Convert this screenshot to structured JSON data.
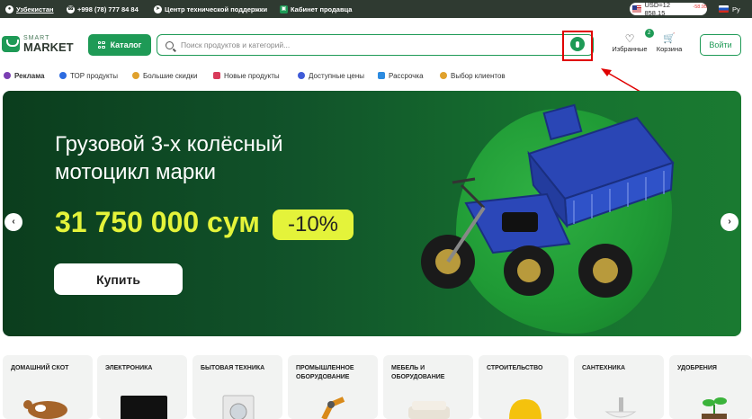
{
  "topbar": {
    "region": "Узбекистан",
    "phone": "+998 (78) 777 84 84",
    "support": "Центр технической поддержки",
    "seller": "Кабинет продавца",
    "currency_value": "USD=12 858.15",
    "currency_delta": "-58.95",
    "language": "Ру"
  },
  "header": {
    "logo_top": "SMART",
    "logo_bottom": "MARKET",
    "catalog_label": "Каталог",
    "search_placeholder": "Поиск продуктов и категорий...",
    "favorites_label": "Избранные",
    "favorites_count": "2",
    "cart_label": "Корзина",
    "login_label": "Войти"
  },
  "nav": {
    "items": [
      {
        "label": "Реклама",
        "color": "#7b3fb3"
      },
      {
        "label": "ТОР продукты",
        "color": "#2c6be0"
      },
      {
        "label": "Большие скидки",
        "color": "#e0a12c"
      },
      {
        "label": "Новые продукты",
        "color": "#d83a5a"
      },
      {
        "label": "Доступные цены",
        "color": "#3f5bd8"
      },
      {
        "label": "Рассрочка",
        "color": "#2c8be0"
      },
      {
        "label": "Выбор клиентов",
        "color": "#e0a12c"
      }
    ]
  },
  "hero": {
    "title": "Грузовой 3-х колёсный мотоцикл марки",
    "price": "31 750 000 сум",
    "discount": "-10%",
    "buy_label": "Купить"
  },
  "categories": [
    {
      "label": "ДОМАШНИЙ СКОТ"
    },
    {
      "label": "ЭЛЕКТРОНИКА"
    },
    {
      "label": "БЫТОВАЯ ТЕХНИКА"
    },
    {
      "label": "ПРОМЫШЛЕННОЕ ОБОРУДОВАНИЕ"
    },
    {
      "label": "МЕБЕЛЬ И ОБОРУДОВАНИЕ"
    },
    {
      "label": "СТРОИТЕЛЬСТВО"
    },
    {
      "label": "САНТЕХНИКА"
    },
    {
      "label": "УДОБРЕНИЯ"
    }
  ],
  "colors": {
    "accent": "#1e9a56",
    "topbar": "#2f3a31",
    "price": "#e4f33a",
    "highlight": "#e00000"
  }
}
